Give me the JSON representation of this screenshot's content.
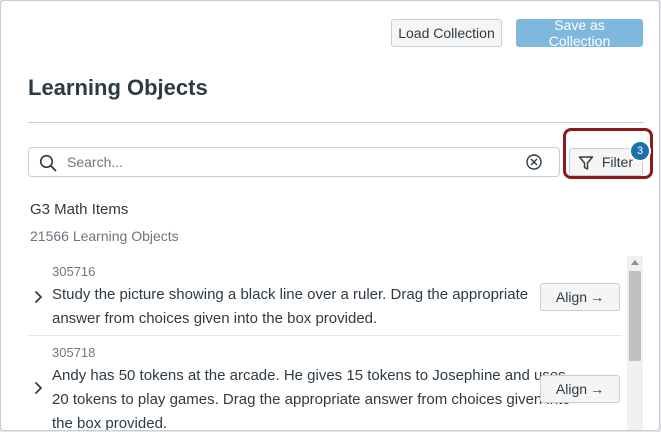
{
  "toolbar": {
    "load_label": "Load Collection",
    "save_label": "Save as Collection"
  },
  "page": {
    "title": "Learning Objects"
  },
  "search": {
    "placeholder": "Search...",
    "value": ""
  },
  "filter": {
    "label": "Filter",
    "badge_count": "3"
  },
  "collection": {
    "name": "G3 Math Items",
    "count_label": "21566 Learning Objects"
  },
  "items": [
    {
      "id": "305716",
      "text": "Study the picture showing a black line over a ruler. Drag the appropriate answer from choices given into the box provided.",
      "align_label": "Align"
    },
    {
      "id": "305718",
      "text": "Andy has 50 tokens at the arcade. He gives 15 tokens to Josephine and uses 20 tokens to play games. Drag the appropriate answer from choices given into the box provided.",
      "align_label": "Align"
    }
  ],
  "icons": {
    "search": "search-icon",
    "clear": "clear-icon",
    "filter": "filter-icon",
    "chevron": "chevron-right-icon",
    "arrow": "arrow-right-icon"
  },
  "colors": {
    "primary_button": "#7fb8dd",
    "badge": "#1b6fa8",
    "highlight": "#8b1a1a",
    "text": "#2d3b45"
  }
}
